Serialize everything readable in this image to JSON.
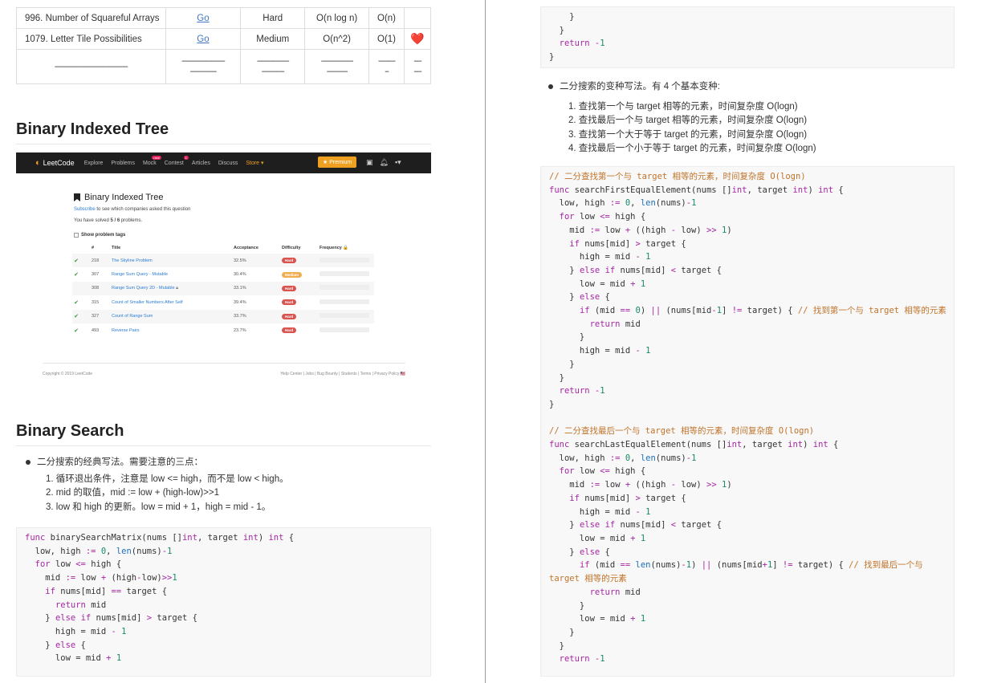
{
  "table": {
    "rows": [
      {
        "title": "996. Number of Squareful Arrays",
        "link": "Go",
        "difficulty": "Hard",
        "time": "O(n log n)",
        "space": "O(n)",
        "mark": ""
      },
      {
        "title": "1079. Letter Tile Possibilities",
        "link": "Go",
        "difficulty": "Medium",
        "time": "O(n^2)",
        "space": "O(1)",
        "mark": "❤️"
      }
    ],
    "dash_row": [
      "---------------------------------------",
      "-----------------------\n--------------",
      "-----------------\n------------",
      "-----------------\n-----------",
      "---------\n--",
      "----\n----"
    ]
  },
  "sections": {
    "bit_heading": "Binary Indexed Tree",
    "bs_heading": "Binary Search"
  },
  "leetcode": {
    "logo": "LeetCode",
    "nav": [
      "Explore",
      "Problems",
      "Mock",
      "Contest",
      "Articles",
      "Discuss",
      "Store ▾"
    ],
    "mock_badge": "new",
    "contest_badge": "1",
    "premium": "★ Premium",
    "page_title": "Binary Indexed Tree",
    "subscribe_link": "Subscribe",
    "subscribe_text": " to see which companies asked this question",
    "solved_prefix": "You have solved ",
    "solved_count": "5 / 6",
    "solved_suffix": " problems.",
    "show_tags": "Show problem tags",
    "columns": [
      "#",
      "Title",
      "Acceptance",
      "Difficulty",
      "Frequency 🔒"
    ],
    "problems": [
      {
        "solved": true,
        "num": "218",
        "title": "The Skyline Problem",
        "acceptance": "32.5%",
        "difficulty": "Hard",
        "locked": false
      },
      {
        "solved": true,
        "num": "307",
        "title": "Range Sum Query - Mutable",
        "acceptance": "30.4%",
        "difficulty": "Medium",
        "locked": false
      },
      {
        "solved": false,
        "num": "308",
        "title": "Range Sum Query 2D - Mutable",
        "acceptance": "33.1%",
        "difficulty": "Hard",
        "locked": true
      },
      {
        "solved": true,
        "num": "315",
        "title": "Count of Smaller Numbers After Self",
        "acceptance": "39.4%",
        "difficulty": "Hard",
        "locked": false
      },
      {
        "solved": true,
        "num": "327",
        "title": "Count of Range Sum",
        "acceptance": "33.7%",
        "difficulty": "Hard",
        "locked": false
      },
      {
        "solved": true,
        "num": "493",
        "title": "Reverse Pairs",
        "acceptance": "23.7%",
        "difficulty": "Hard",
        "locked": false
      }
    ],
    "copyright": "Copyright © 2019 LeetCode",
    "footer_links": "Help Center  |  Jobs  |  Bug Bounty  |  Students  |  Terms  |  Privacy Policy"
  },
  "bs_bullet": {
    "text": "二分搜索的经典写法。需要注意的三点：",
    "items": [
      "1. 循环退出条件，注意是 low <= high，而不是 low < high。",
      "2. mid 的取值，mid := low + (high-low)>>1",
      "3. low 和 high 的更新。low = mid + 1，high = mid - 1。"
    ]
  },
  "variant_bullet": {
    "text": "二分搜索的变种写法。有 4 个基本变种:",
    "items": [
      "1. 查找第一个与 target 相等的元素，时间复杂度 O(logn)",
      "2. 查找最后一个与 target 相等的元素，时间复杂度 O(logn)",
      "3. 查找第一个大于等于 target 的元素，时间复杂度 O(logn)",
      "4. 查找最后一个小于等于 target 的元素，时间复杂度 O(logn)"
    ]
  },
  "code": {
    "left_matrix": "func binarySearchMatrix(nums []int, target int) int {\n  low, high := 0, len(nums)-1\n  for low <= high {\n    mid := low + (high-low)>>1\n    if nums[mid] == target {\n      return mid\n    } else if nums[mid] > target {\n      high = mid - 1\n    } else {\n      low = mid + 1",
    "right_top": "    }\n  }\n  return -1\n}",
    "right_main": "// 二分查找第一个与 target 相等的元素，时间复杂度 O(logn)\nfunc searchFirstEqualElement(nums []int, target int) int {\n  low, high := 0, len(nums)-1\n  for low <= high {\n    mid := low + ((high - low) >> 1)\n    if nums[mid] > target {\n      high = mid - 1\n    } else if nums[mid] < target {\n      low = mid + 1\n    } else {\n      if (mid == 0) || (nums[mid-1] != target) { // 找到第一个与 target 相等的元素\n        return mid\n      }\n      high = mid - 1\n    }\n  }\n  return -1\n}\n\n// 二分查找最后一个与 target 相等的元素，时间复杂度 O(logn)\nfunc searchLastEqualElement(nums []int, target int) int {\n  low, high := 0, len(nums)-1\n  for low <= high {\n    mid := low + ((high - low) >> 1)\n    if nums[mid] > target {\n      high = mid - 1\n    } else if nums[mid] < target {\n      low = mid + 1\n    } else {\n      if (mid == len(nums)-1) || (nums[mid+1] != target) { // 找到最后一个与\ntarget 相等的元素\n        return mid\n      }\n      low = mid + 1\n    }\n  }\n  return -1"
  }
}
